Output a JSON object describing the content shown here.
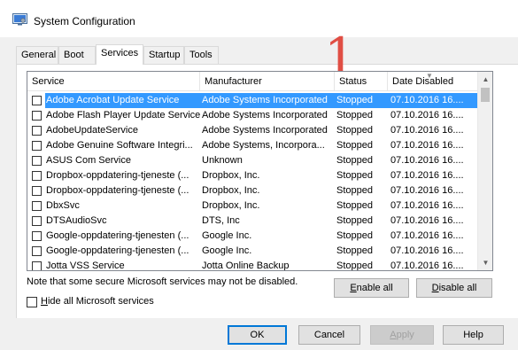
{
  "window": {
    "title": "System Configuration",
    "icon": "msconfig-icon"
  },
  "tabs": [
    {
      "label": "General"
    },
    {
      "label": "Boot"
    },
    {
      "label": "Services",
      "active": true
    },
    {
      "label": "Startup"
    },
    {
      "label": "Tools"
    }
  ],
  "annotation": "1",
  "list": {
    "columns": [
      "Service",
      "Manufacturer",
      "Status",
      "Date Disabled"
    ],
    "rows": [
      {
        "service": "Adobe Acrobat Update Service",
        "manufacturer": "Adobe Systems Incorporated",
        "status": "Stopped",
        "date": "07.10.2016 16....",
        "selected": true
      },
      {
        "service": "Adobe Flash Player Update Service",
        "manufacturer": "Adobe Systems Incorporated",
        "status": "Stopped",
        "date": "07.10.2016 16...."
      },
      {
        "service": "AdobeUpdateService",
        "manufacturer": "Adobe Systems Incorporated",
        "status": "Stopped",
        "date": "07.10.2016 16...."
      },
      {
        "service": "Adobe Genuine Software Integri...",
        "manufacturer": "Adobe Systems, Incorpora...",
        "status": "Stopped",
        "date": "07.10.2016 16...."
      },
      {
        "service": "ASUS Com Service",
        "manufacturer": "Unknown",
        "status": "Stopped",
        "date": "07.10.2016 16...."
      },
      {
        "service": "Dropbox-oppdatering-tjeneste (...",
        "manufacturer": "Dropbox, Inc.",
        "status": "Stopped",
        "date": "07.10.2016 16...."
      },
      {
        "service": "Dropbox-oppdatering-tjeneste (...",
        "manufacturer": "Dropbox, Inc.",
        "status": "Stopped",
        "date": "07.10.2016 16...."
      },
      {
        "service": "DbxSvc",
        "manufacturer": "Dropbox, Inc.",
        "status": "Stopped",
        "date": "07.10.2016 16...."
      },
      {
        "service": "DTSAudioSvc",
        "manufacturer": "DTS, Inc",
        "status": "Stopped",
        "date": "07.10.2016 16...."
      },
      {
        "service": "Google-oppdatering-tjenesten (...",
        "manufacturer": "Google Inc.",
        "status": "Stopped",
        "date": "07.10.2016 16...."
      },
      {
        "service": "Google-oppdatering-tjenesten (...",
        "manufacturer": "Google Inc.",
        "status": "Stopped",
        "date": "07.10.2016 16...."
      },
      {
        "service": "Jotta VSS Service",
        "manufacturer": "Jotta Online Backup",
        "status": "Stopped",
        "date": "07.10.2016 16...."
      }
    ]
  },
  "note": "Note that some secure Microsoft services may not be disabled.",
  "buttons": {
    "enable_all_u": "E",
    "enable_all_rest": "nable all",
    "disable_all_u": "D",
    "disable_all_rest": "isable all",
    "ok": "OK",
    "cancel": "Cancel",
    "apply_u": "A",
    "apply_rest": "pply",
    "help": "Help"
  },
  "hide_ms": {
    "label_u": "H",
    "label_rest": "ide all Microsoft services",
    "checked": false
  },
  "colors": {
    "selection": "#3399ff",
    "annotation": "#e04e44",
    "primary_border": "#0078d7"
  }
}
